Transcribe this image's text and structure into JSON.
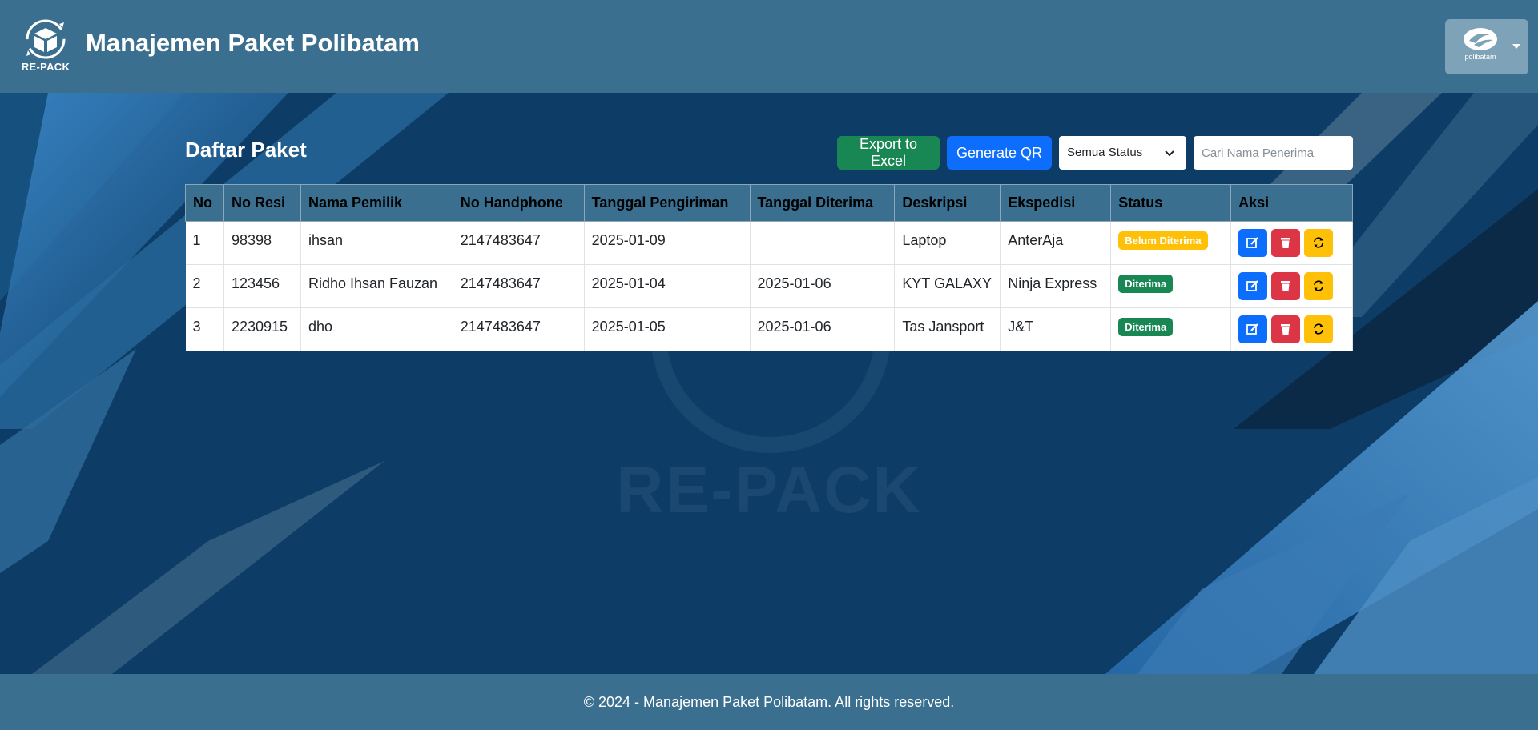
{
  "header": {
    "logo_text": "RE-PACK",
    "title": "Manajemen Paket Polibatam",
    "user_logo_text": "polibatam"
  },
  "main": {
    "title": "Daftar Paket",
    "export_label": "Export to Excel",
    "qr_label": "Generate QR",
    "status_selected": "Semua Status",
    "search_placeholder": "Cari Nama Penerima",
    "watermark": "RE-PACK"
  },
  "table": {
    "headers": [
      "No",
      "No Resi",
      "Nama Pemilik",
      "No Handphone",
      "Tanggal Pengiriman",
      "Tanggal Diterima",
      "Deskripsi",
      "Ekspedisi",
      "Status",
      "Aksi"
    ],
    "rows": [
      {
        "no": "1",
        "resi": "98398",
        "pemilik": "ihsan",
        "hp": "2147483647",
        "kirim": "2025-01-09",
        "terima": "",
        "deskripsi": "Laptop",
        "ekspedisi": "AnterAja",
        "status": "Belum Diterima",
        "status_color": "#ffc107"
      },
      {
        "no": "2",
        "resi": "123456",
        "pemilik": "Ridho Ihsan Fauzan",
        "hp": "2147483647",
        "kirim": "2025-01-04",
        "terima": "2025-01-06",
        "deskripsi": "KYT GALAXY",
        "ekspedisi": "Ninja Express",
        "status": "Diterima",
        "status_color": "#198754"
      },
      {
        "no": "3",
        "resi": "2230915",
        "pemilik": "dho",
        "hp": "2147483647",
        "kirim": "2025-01-05",
        "terima": "2025-01-06",
        "deskripsi": "Tas Jansport",
        "ekspedisi": "J&T",
        "status": "Diterima",
        "status_color": "#198754"
      }
    ],
    "action_icons": [
      "edit-icon",
      "trash-icon",
      "sync-icon"
    ]
  },
  "footer": {
    "text": "© 2024 - Manajemen Paket Polibatam. All rights reserved."
  },
  "colors": {
    "header_bg": "#3a6f8f",
    "page_bg": "#0e3a62",
    "excel_button": "#198754",
    "qr_button": "#0d6efd",
    "edit_button": "#0d6efd",
    "delete_button": "#dc3545",
    "sync_button": "#ffc107"
  }
}
